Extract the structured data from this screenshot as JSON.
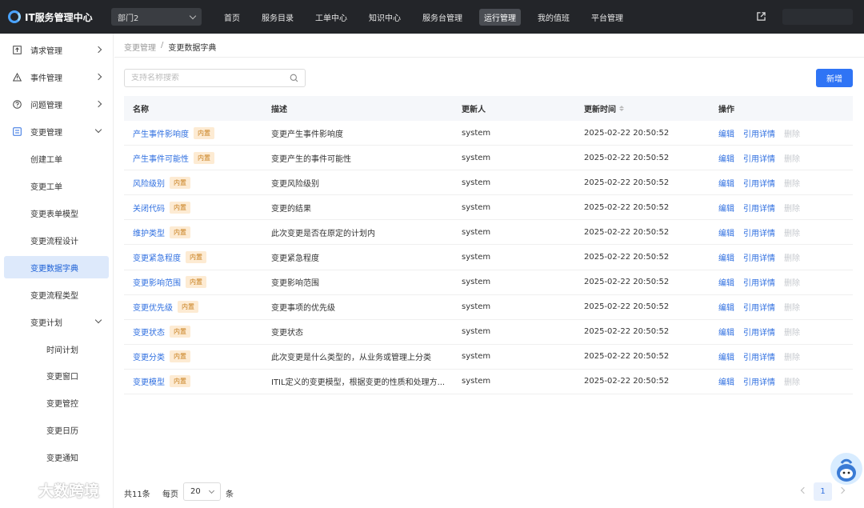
{
  "app": {
    "title": "IT服务管理中心",
    "dept": "部门2"
  },
  "nav": [
    "首页",
    "服务目录",
    "工单中心",
    "知识中心",
    "服务台管理",
    "运行管理",
    "我的值班",
    "平台管理"
  ],
  "nav_active_index": 5,
  "sidebar": {
    "items": [
      {
        "label": "请求管理",
        "icon": "upload-icon"
      },
      {
        "label": "事件管理",
        "icon": "warning-icon"
      },
      {
        "label": "问题管理",
        "icon": "question-icon"
      },
      {
        "label": "变更管理",
        "icon": "change-icon"
      },
      {
        "label": "创建工单"
      },
      {
        "label": "变更工单"
      },
      {
        "label": "变更表单模型"
      },
      {
        "label": "变更流程设计"
      },
      {
        "label": "变更数据字典"
      },
      {
        "label": "变更流程类型"
      },
      {
        "label": "变更计划"
      },
      {
        "label": "时间计划"
      },
      {
        "label": "变更窗口"
      },
      {
        "label": "变更管控"
      },
      {
        "label": "变更日历"
      },
      {
        "label": "变更通知"
      }
    ]
  },
  "breadcrumb": {
    "parent": "变更管理",
    "separator": "/",
    "current": "变更数据字典"
  },
  "search": {
    "placeholder": "支持名称搜索"
  },
  "add_button": "新增",
  "table": {
    "headers": [
      "名称",
      "描述",
      "更新人",
      "更新时间",
      "操作"
    ],
    "tag": "内置",
    "ops": [
      "编辑",
      "引用详情",
      "删除"
    ],
    "rows": [
      {
        "name": "产生事件影响度",
        "desc": "变更产生事件影响度",
        "user": "system",
        "time": "2025-02-22 20:50:52"
      },
      {
        "name": "产生事件可能性",
        "desc": "变更产生的事件可能性",
        "user": "system",
        "time": "2025-02-22 20:50:52"
      },
      {
        "name": "风险级别",
        "desc": "变更风险级别",
        "user": "system",
        "time": "2025-02-22 20:50:52"
      },
      {
        "name": "关闭代码",
        "desc": "变更的结果",
        "user": "system",
        "time": "2025-02-22 20:50:52"
      },
      {
        "name": "维护类型",
        "desc": "此次变更是否在原定的计划内",
        "user": "system",
        "time": "2025-02-22 20:50:52"
      },
      {
        "name": "变更紧急程度",
        "desc": "变更紧急程度",
        "user": "system",
        "time": "2025-02-22 20:50:52"
      },
      {
        "name": "变更影响范围",
        "desc": "变更影响范围",
        "user": "system",
        "time": "2025-02-22 20:50:52"
      },
      {
        "name": "变更优先级",
        "desc": "变更事项的优先级",
        "user": "system",
        "time": "2025-02-22 20:50:52"
      },
      {
        "name": "变更状态",
        "desc": "变更状态",
        "user": "system",
        "time": "2025-02-22 20:50:52"
      },
      {
        "name": "变更分类",
        "desc": "此次变更是什么类型的，从业务或管理上分类",
        "user": "system",
        "time": "2025-02-22 20:50:52"
      },
      {
        "name": "变更模型",
        "desc": "ITIL定义的变更模型，根据变更的性质和处理方...",
        "user": "system",
        "time": "2025-02-22 20:50:52"
      }
    ]
  },
  "pagination": {
    "total": "共11条",
    "per_page_label": "每页",
    "page_size": "20",
    "unit": "条",
    "current_page": "1"
  },
  "watermark": "大数跨境",
  "colors": {
    "primary": "#2f74f5",
    "topbar": "#232529",
    "tag_bg": "#fdebd3",
    "tag_text": "#c77d1a",
    "link": "#2f6fe0"
  }
}
